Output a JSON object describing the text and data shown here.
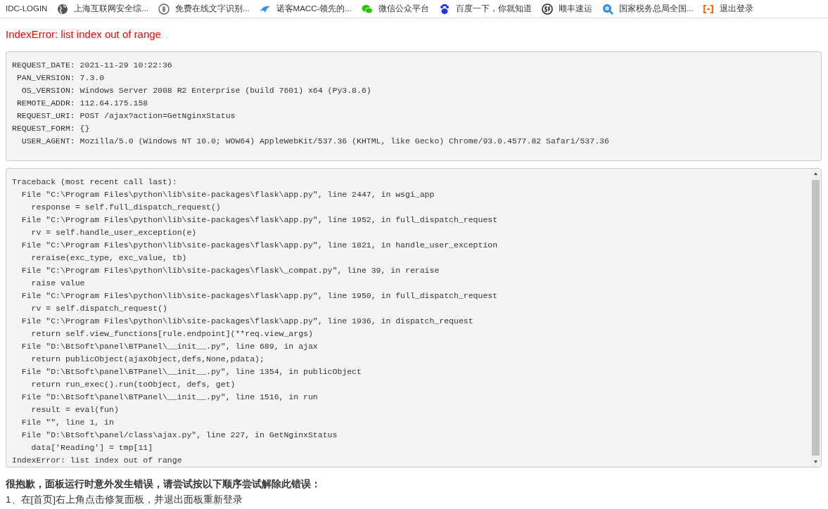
{
  "bookmarks": [
    {
      "label": "IDC-LOGIN",
      "kind": "none"
    },
    {
      "label": "上海互联网安全综...",
      "kind": "globe"
    },
    {
      "label": "免费在线文字识别...",
      "kind": "circle"
    },
    {
      "label": "诺客MACC-领先的...",
      "kind": "wing"
    },
    {
      "label": "微信公众平台",
      "kind": "chat"
    },
    {
      "label": "百度一下，你就知道",
      "kind": "paw"
    },
    {
      "label": "顺丰速运",
      "kind": "sf"
    },
    {
      "label": "国家税务总局全国...",
      "kind": "magnifier"
    },
    {
      "label": "退出登录",
      "kind": "bracket"
    }
  ],
  "error_title": "IndexError: list index out of range",
  "request_info": [
    "REQUEST_DATE: 2021-11-29 10:22:36",
    " PAN_VERSION: 7.3.0",
    "  OS_VERSION: Windows Server 2008 R2 Enterprise (build 7601) x64 (Py3.8.6)",
    " REMOTE_ADDR: 112.64.175.158",
    " REQUEST_URI: POST /ajax?action=GetNginxStatus",
    "REQUEST_FORM: {}",
    "  USER_AGENT: Mozilla/5.0 (Windows NT 10.0; WOW64) AppleWebKit/537.36 (KHTML, like Gecko) Chrome/93.0.4577.82 Safari/537.36"
  ],
  "traceback": [
    "Traceback (most recent call last):",
    "  File \"C:\\Program Files\\python\\lib\\site-packages\\flask\\app.py\", line 2447, in wsgi_app",
    "    response = self.full_dispatch_request()",
    "  File \"C:\\Program Files\\python\\lib\\site-packages\\flask\\app.py\", line 1952, in full_dispatch_request",
    "    rv = self.handle_user_exception(e)",
    "  File \"C:\\Program Files\\python\\lib\\site-packages\\flask\\app.py\", line 1821, in handle_user_exception",
    "    reraise(exc_type, exc_value, tb)",
    "  File \"C:\\Program Files\\python\\lib\\site-packages\\flask\\_compat.py\", line 39, in reraise",
    "    raise value",
    "  File \"C:\\Program Files\\python\\lib\\site-packages\\flask\\app.py\", line 1950, in full_dispatch_request",
    "    rv = self.dispatch_request()",
    "  File \"C:\\Program Files\\python\\lib\\site-packages\\flask\\app.py\", line 1936, in dispatch_request",
    "    return self.view_functions[rule.endpoint](**req.view_args)",
    "  File \"D:\\BtSoft\\panel\\BTPanel\\__init__.py\", line 689, in ajax",
    "    return publicObject(ajaxObject,defs,None,pdata);",
    "  File \"D:\\BtSoft\\panel\\BTPanel\\__init__.py\", line 1354, in publicObject",
    "    return run_exec().run(toObject, defs, get)",
    "  File \"D:\\BtSoft\\panel\\BTPanel\\__init__.py\", line 1516, in run",
    "    result = eval(fun)",
    "  File \"\", line 1, in",
    "  File \"D:\\BtSoft\\panel/class\\ajax.py\", line 227, in GetNginxStatus",
    "    data['Reading'] = tmp[11]",
    "IndexError: list index out of range"
  ],
  "help_title": "很抱歉，面板运行时意外发生错误，请尝试按以下顺序尝试解除此错误：",
  "help_steps": [
    "1、在[首页]右上角点击修复面板，并退出面板重新登录"
  ]
}
